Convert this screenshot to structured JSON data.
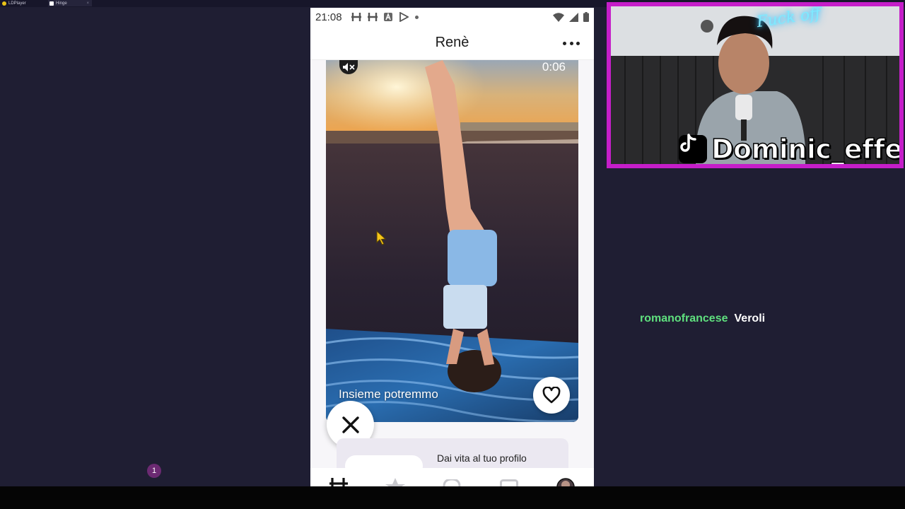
{
  "host": {
    "tabs": [
      {
        "label": "LDPlayer"
      },
      {
        "label": "Hinge",
        "close": "×"
      }
    ]
  },
  "phone": {
    "status": {
      "time": "21:08",
      "notification_icons": [
        "hinge-icon",
        "hinge-icon",
        "a-icon",
        "play-store-icon",
        "dot-icon"
      ],
      "right_icons": [
        "wifi-icon",
        "signal-icon",
        "battery-icon"
      ]
    },
    "header": {
      "name": "Renè",
      "menu_icon": "more-horizontal-icon"
    },
    "video": {
      "timer": "0:06",
      "mute_icon": "speaker-muted-icon",
      "caption": "Insieme potremmo",
      "like_icon": "heart-icon"
    },
    "skip_icon": "close-icon",
    "promo": {
      "text": "Dai vita al tuo profilo"
    },
    "nav": {
      "items": [
        {
          "icon": "hinge-discover-icon"
        },
        {
          "icon": "star-icon"
        },
        {
          "icon": "likes-icon"
        },
        {
          "icon": "chat-icon"
        },
        {
          "icon": "profile-avatar-icon"
        }
      ],
      "badge": "1"
    }
  },
  "webcam": {
    "neon_sign": "Fuck off",
    "tiktok_handle": "Dominic_effe"
  },
  "chat": {
    "username": "romanofrancese",
    "message": "Veroli"
  },
  "colors": {
    "background": "#1f1e33",
    "webcam_border": "#c51ec9",
    "chat_username": "#5fe07e",
    "badge": "#6b2a72"
  }
}
